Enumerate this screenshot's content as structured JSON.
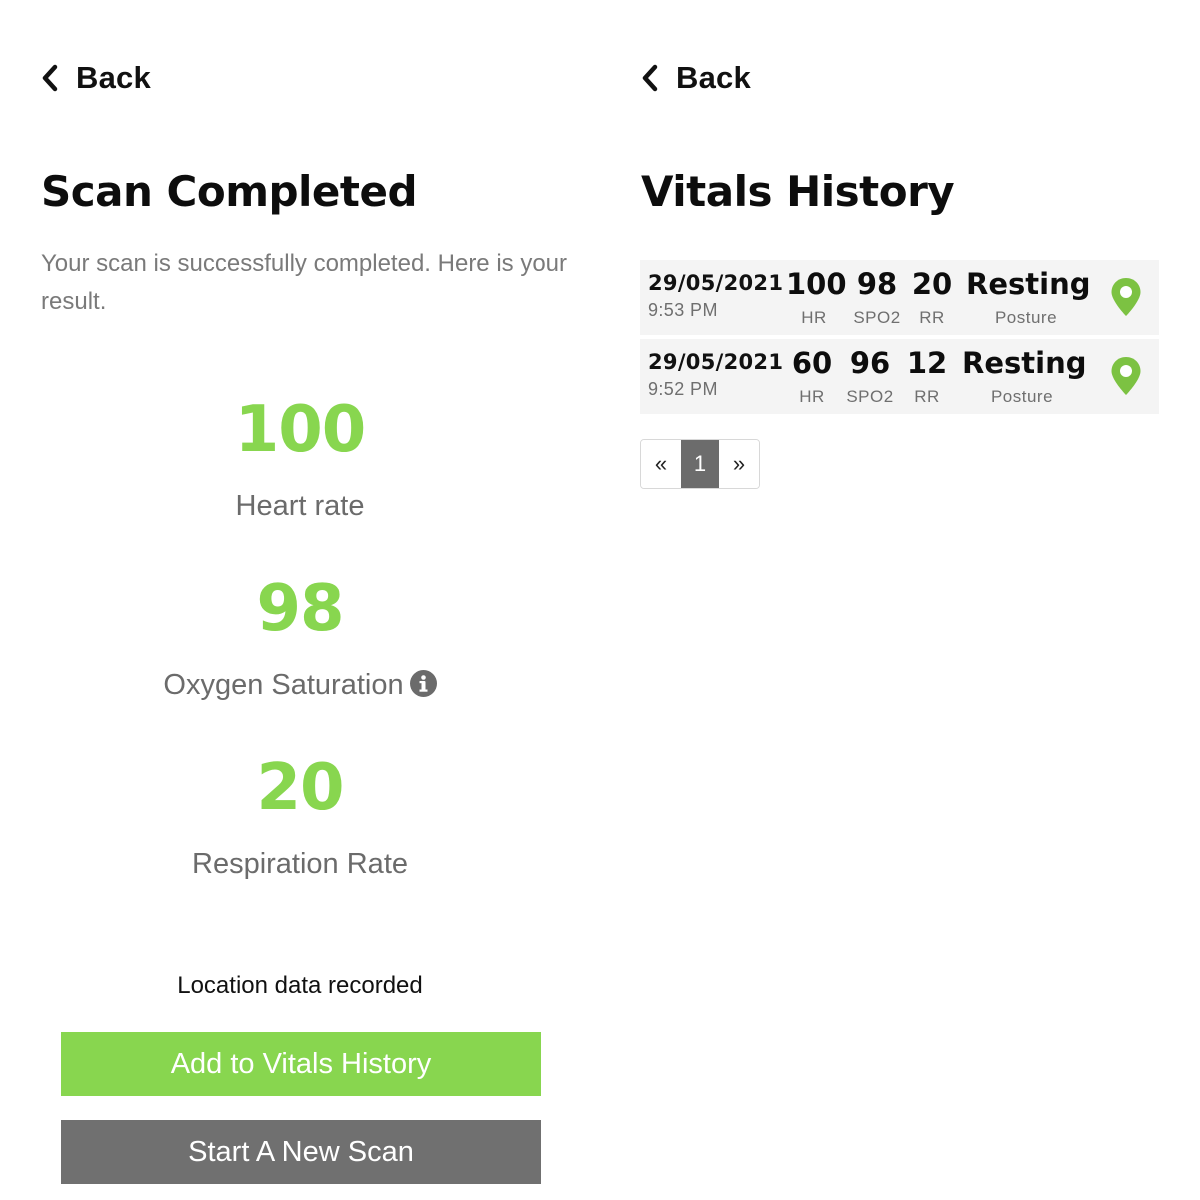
{
  "colors": {
    "accent_green": "#88d64f",
    "pin_green": "#7cc242",
    "button_gray": "#707070",
    "active_page_gray": "#6c6c6c"
  },
  "scan_screen": {
    "back_label": "Back",
    "back_icon": "chevron-left-icon",
    "title": "Scan Completed",
    "subtitle": "Your scan is successfully completed. Here is your result.",
    "metrics": [
      {
        "value": "100",
        "label": "Heart rate"
      },
      {
        "value": "98",
        "label": "Oxygen Saturation",
        "icon": "info-icon"
      },
      {
        "value": "20",
        "label": "Respiration Rate"
      }
    ],
    "location_note": "Location data recorded",
    "add_button_label": "Add to Vitals History",
    "new_scan_button_label": "Start A New Scan"
  },
  "history_screen": {
    "back_label": "Back",
    "back_icon": "chevron-left-icon",
    "title": "Vitals History",
    "rows": [
      {
        "date": "29/05/2021",
        "time": "9:53 PM",
        "hr": "100",
        "hr_unit": "HR",
        "spo2": "98",
        "spo2_unit": "SPO2",
        "rr": "20",
        "rr_unit": "RR",
        "posture": "Resting",
        "posture_label": "Posture",
        "icon": "map-pin-icon"
      },
      {
        "date": "29/05/2021",
        "time": "9:52 PM",
        "hr": "60",
        "hr_unit": "HR",
        "spo2": "96",
        "spo2_unit": "SPO2",
        "rr": "12",
        "rr_unit": "RR",
        "posture": "Resting",
        "posture_label": "Posture",
        "icon": "map-pin-icon"
      }
    ],
    "pagination": {
      "prev": "«",
      "current": "1",
      "next": "»"
    }
  }
}
